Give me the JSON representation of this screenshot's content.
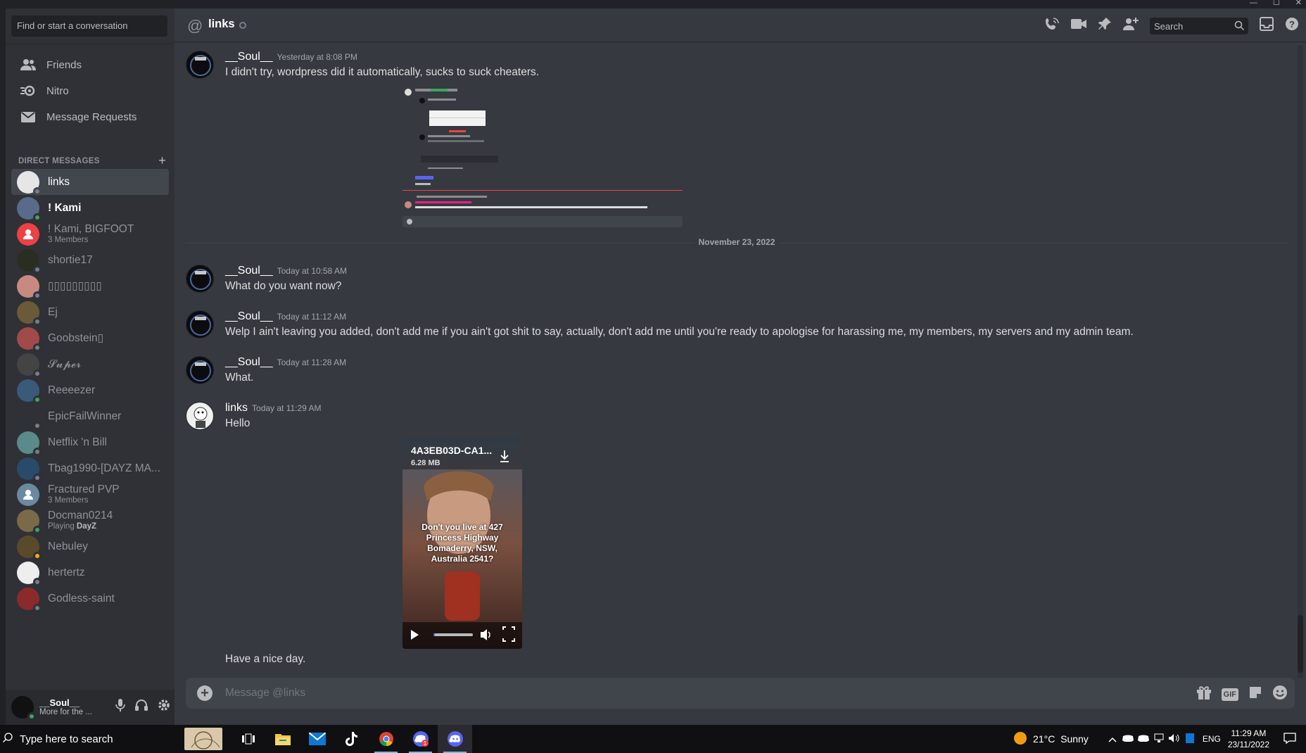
{
  "window": {
    "controls": [
      "—",
      "☐",
      "✕"
    ]
  },
  "sidebar": {
    "search_placeholder": "Find or start a conversation",
    "nav": [
      {
        "label": "Friends",
        "icon": "friends-icon"
      },
      {
        "label": "Nitro",
        "icon": "nitro-icon"
      },
      {
        "label": "Message Requests",
        "icon": "envelope-icon"
      }
    ],
    "dm_header": "DIRECT MESSAGES",
    "dm_add": "+",
    "dms": [
      {
        "name": "links",
        "status": "offline",
        "active": true,
        "avatar_color": "#e6e6e6"
      },
      {
        "name": "! Kami",
        "status": "online",
        "bold": true,
        "avatar_color": "#5a6a8a"
      },
      {
        "name": "! Kami, BIGFOOT",
        "sub": "3 Members",
        "status": "none",
        "avatar_color": "#ed4245"
      },
      {
        "name": "shortie17",
        "status": "offline",
        "avatar_color": "#2a2e22"
      },
      {
        "name": "▯▯▯▯▯▯▯▯▯",
        "status": "offline",
        "avatar_color": "#c88a80"
      },
      {
        "name": "Ej",
        "status": "offline",
        "avatar_color": "#6b5a3a"
      },
      {
        "name": "Goobstein▯",
        "status": "offline",
        "avatar_color": "#a04a4a"
      },
      {
        "name": "𝓢𝓾𝓹𝓮𝓻",
        "status": "offline",
        "avatar_color": "#444"
      },
      {
        "name": "Reeeezer",
        "status": "online",
        "avatar_color": "#3a5a7a"
      },
      {
        "name": "EpicFailWinner",
        "status": "offline",
        "avatar_color": "#2f3136"
      },
      {
        "name": "Netflix 'n Bill",
        "status": "offline",
        "avatar_color": "#5a8a8a"
      },
      {
        "name": "Tbag1990-[DAYZ MA...",
        "status": "offline",
        "avatar_color": "#2a4a6a"
      },
      {
        "name": "Fractured PVP",
        "sub": "3 Members",
        "status": "none",
        "avatar_color": "#6a8aa0"
      },
      {
        "name": "Docman0214",
        "sub_prefix": "Playing ",
        "sub_bold": "DayZ",
        "status": "online",
        "avatar_color": "#7a6a4a"
      },
      {
        "name": "Nebuley",
        "status": "idle",
        "avatar_color": "#5a4a2a"
      },
      {
        "name": "hertertz",
        "status": "offline",
        "avatar_color": "#eeeeee"
      },
      {
        "name": "Godless-saint",
        "status": "offline",
        "avatar_color": "#8a2a2a"
      }
    ],
    "user": {
      "name": "__Soul__",
      "status_text": "More for the ..."
    }
  },
  "header": {
    "channel": "links",
    "search_placeholder": "Search"
  },
  "messages": [
    {
      "author": "__Soul__",
      "time": "Yesterday at 8:08 PM",
      "text": "I didn't try, wordpress did it automatically, sucks to suck cheaters."
    },
    {
      "author": "__Soul__",
      "time": "Today at 10:58 AM",
      "text": "What do you want now?"
    },
    {
      "author": "__Soul__",
      "time": "Today at 11:12 AM",
      "text": "Welp I ain't leaving you added, don't add me if you ain't got shit to say, actually, don't add me until you're ready to apologise for harassing me, my members, my servers and my admin team."
    },
    {
      "author": "__Soul__",
      "time": "Today at 11:28 AM",
      "text": "What."
    },
    {
      "author": "links",
      "time": "Today at 11:29 AM",
      "text": "Hello",
      "followup": "Have a nice day."
    }
  ],
  "date_separator": "November 23, 2022",
  "video": {
    "filename": "4A3EB03D-CA1...",
    "size": "6.28 MB",
    "caption": "Don't you live at 427 Princess Highway Bomaderry, NSW, Australia 2541?",
    "progress": 0.0
  },
  "composer": {
    "placeholder": "Message @links",
    "gif_label": "GIF"
  },
  "taskbar": {
    "search": "Type here to search",
    "weather": "21°C  Sunny",
    "lang": "ENG",
    "time": "11:29 AM",
    "date": "23/11/2022"
  },
  "colors": {
    "accent": "#5865f2",
    "online": "#3ba55d",
    "idle": "#faa81a",
    "offline": "#747f8d",
    "red": "#ed4245"
  }
}
